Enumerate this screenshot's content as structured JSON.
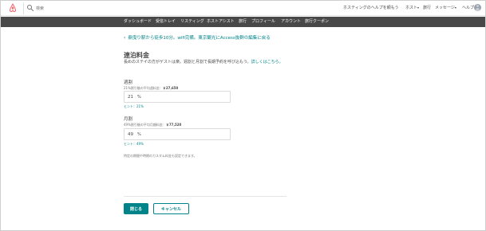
{
  "header": {
    "logo_icon": "airbnb-logo-icon",
    "search": {
      "placeholder": "検索",
      "icon": "search-icon"
    },
    "links": {
      "help_hosting": "ホスティングのヘルプを頼もう",
      "host": "ホスト",
      "trips": "旅行",
      "messages": "メッセージ",
      "help": "ヘルプ"
    },
    "brand_color": "#FF5A5F"
  },
  "nav": {
    "items": [
      "ダッシュボード",
      "受信トレイ",
      "リスティング",
      "ホストアシスト",
      "旅行",
      "プロフィール",
      "アカウント",
      "旅行クーポン"
    ]
  },
  "main": {
    "back_link": "鼎曳り駅から徒歩10分。wifi完備。東京観光にAccess抜群の編集に戻る",
    "title": "連泊料金",
    "description": "長めのステイの方がゲストは楽。週割と月割で長期予約を呼び込もう。",
    "description_link": "詳しくはこちら。",
    "weekly": {
      "label": "週割",
      "sub_text": "21%割引後の平均週料金：",
      "sub_value": "￥27,650",
      "value": "21",
      "unit": "%",
      "hint": "ヒント：21%"
    },
    "monthly": {
      "label": "月割",
      "sub_text": "49%割引後の平均月額料金：",
      "sub_value": "￥77,520",
      "value": "49",
      "unit": "%",
      "hint": "ヒント：49%"
    },
    "custom_note": "特定の期間や時期のカスタム料金も設定できます。"
  },
  "footer": {
    "close_label": "閉じる",
    "cancel_label": "キャンセル"
  },
  "colors": {
    "accent": "#008489",
    "nav_bg": "#484848",
    "text": "#484848"
  }
}
